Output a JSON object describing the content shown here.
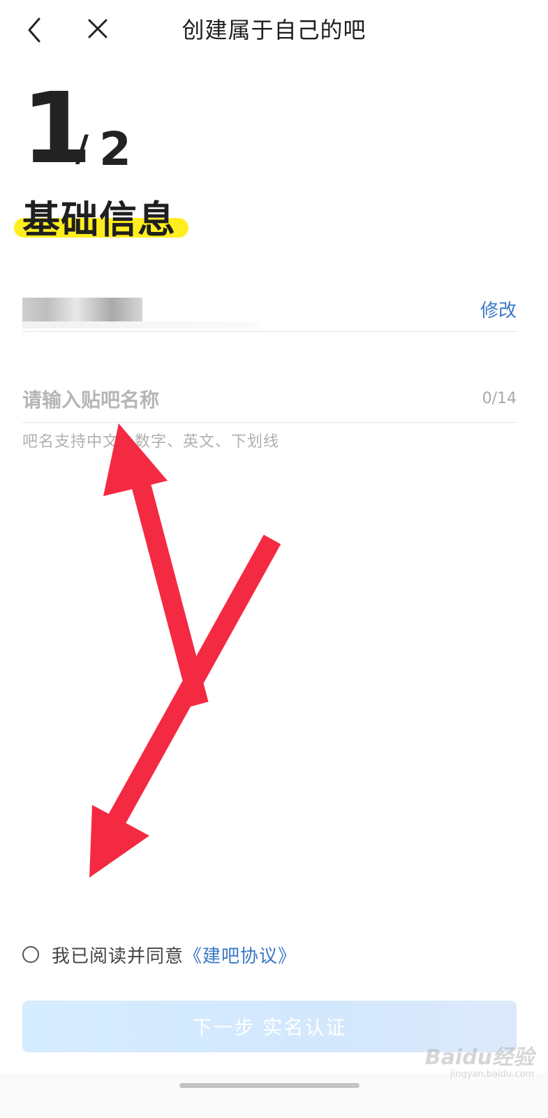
{
  "header": {
    "title": "创建属于自己的吧",
    "back_icon": "chevron-left-icon",
    "close_icon": "close-icon"
  },
  "step": {
    "current": "1",
    "separator": "/",
    "total": "2"
  },
  "section": {
    "title": "基础信息",
    "highlight_color": "#ffee1f"
  },
  "category_row": {
    "edit_label": "修改"
  },
  "name_field": {
    "placeholder": "请输入贴吧名称",
    "value": "",
    "counter": "0/14",
    "hint": "吧名支持中文、数字、英文、下划线"
  },
  "agreement": {
    "checked": false,
    "text": "我已阅读并同意",
    "link": "《建吧协议》"
  },
  "next_button": {
    "label": "下一步 实名认证",
    "disabled": true
  },
  "annotation": {
    "arrow_color": "#f42a42"
  },
  "watermark": {
    "logo": "Baidu经验",
    "url": "jingyan.baidu.com"
  },
  "colors": {
    "link": "#3a78c9",
    "button_bg": "#d6ecff"
  }
}
